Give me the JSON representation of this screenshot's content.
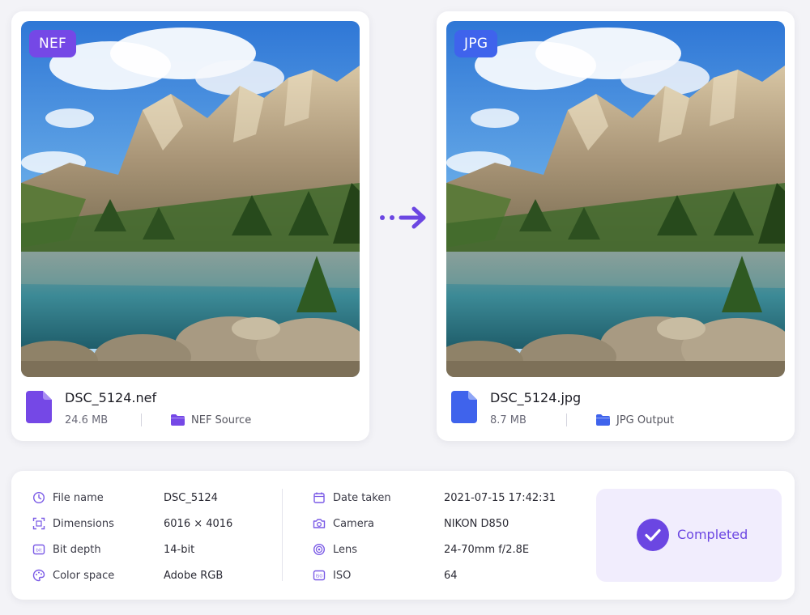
{
  "source": {
    "badge": "NEF",
    "file_name": "DSC_5124.nef",
    "file_size": "24.6 MB",
    "folder": "NEF Source",
    "accent_color": "#7548e6",
    "icon": "file-icon",
    "folder_icon": "folder-icon"
  },
  "output": {
    "badge": "JPG",
    "file_name": "DSC_5124.jpg",
    "file_size": "8.7 MB",
    "folder": "JPG Output",
    "accent_color": "#3f63ec",
    "icon": "file-icon",
    "folder_icon": "folder-icon"
  },
  "conversion_arrow_icon": "dotted-arrow-right-icon",
  "metadata": {
    "left": [
      {
        "icon": "clock-icon",
        "label": "File name",
        "value": "DSC_5124"
      },
      {
        "icon": "dimensions-icon",
        "label": "Dimensions",
        "value": "6016 × 4016"
      },
      {
        "icon": "bit-depth-icon",
        "label": "Bit depth",
        "value": "14-bit"
      },
      {
        "icon": "palette-icon",
        "label": "Color space",
        "value": "Adobe RGB"
      }
    ],
    "right": [
      {
        "icon": "calendar-icon",
        "label": "Date taken",
        "value": "2021-07-15 17:42:31"
      },
      {
        "icon": "camera-icon",
        "label": "Camera",
        "value": "NIKON D850"
      },
      {
        "icon": "lens-icon",
        "label": "Lens",
        "value": "24-70mm f/2.8E"
      },
      {
        "icon": "iso-icon",
        "label": "ISO",
        "value": "64"
      }
    ]
  },
  "status": {
    "label": "Completed",
    "icon": "check-circle-icon",
    "color": "#6b46e2"
  }
}
